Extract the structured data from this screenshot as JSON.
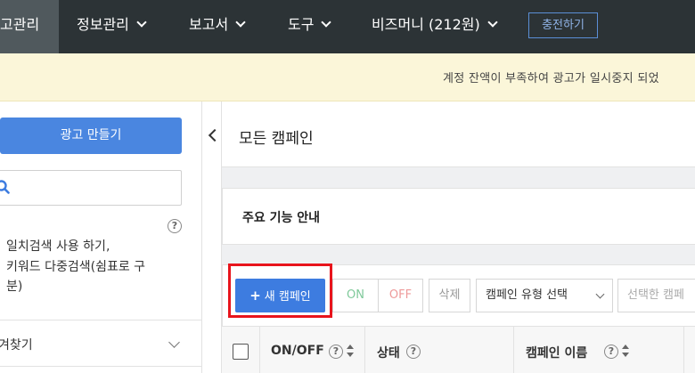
{
  "topnav": {
    "items": [
      {
        "label": "고관리"
      },
      {
        "label": "정보관리"
      },
      {
        "label": "보고서"
      },
      {
        "label": "도구"
      },
      {
        "label": "비즈머니 (212원)"
      }
    ],
    "charge_button": "충전하기"
  },
  "notice": {
    "text": "계정 잔액이 부족하여 광고가 일시중지 되었"
  },
  "sidebar": {
    "create_button": "광고 만들기",
    "search_placeholder": "",
    "help_symbol": "?",
    "options": [
      "일치검색 사용 하기,",
      "키워드 다중검색(쉼표로 구",
      "분)"
    ],
    "favorites_label": "겨찾기"
  },
  "main": {
    "title": "모든 캠페인",
    "guide_title": "주요 기능 안내",
    "toolbar": {
      "new_campaign": "새 캠페인",
      "new_campaign_symbol": "+",
      "on": "ON",
      "off": "OFF",
      "delete": "삭제",
      "type_select": "캠페인 유형 선택",
      "selected_action": "선택한 캠페"
    },
    "table": {
      "headers": [
        "ON/OFF",
        "상태",
        "캠페인 이름"
      ],
      "help_symbol": "?"
    }
  },
  "colors": {
    "nav_bg": "#2c3336",
    "notice_bg": "#fbf6d9",
    "primary": "#3d7ce0",
    "highlight": "#e8141c",
    "on_green": "#7fc99a",
    "off_red": "#ee9a9a"
  }
}
